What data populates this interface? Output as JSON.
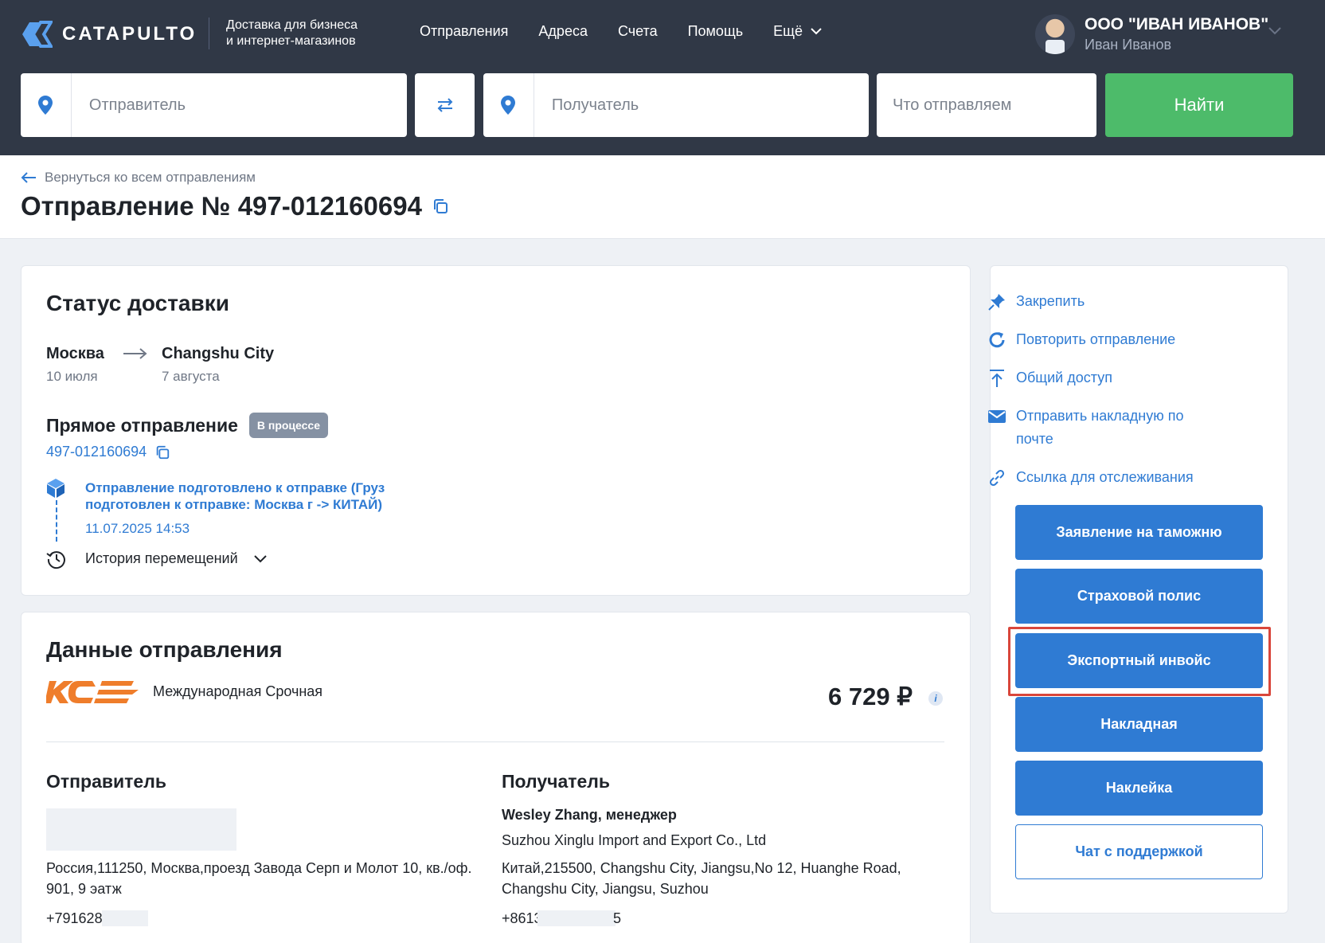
{
  "header": {
    "brand": "CATAPULTO",
    "tagline_line1": "Доставка для бизнеса",
    "tagline_line2": "и интернет-магазинов",
    "nav": [
      {
        "label": "Отправления"
      },
      {
        "label": "Адреса"
      },
      {
        "label": "Счета"
      },
      {
        "label": "Помощь"
      },
      {
        "label": "Ещё"
      }
    ],
    "account": {
      "company": "ООО \"ИВАН ИВАНОВ\"",
      "user": "Иван Иванов"
    }
  },
  "search": {
    "sender_placeholder": "Отправитель",
    "recipient_placeholder": "Получатель",
    "what_placeholder": "Что отправляем",
    "find_label": "Найти"
  },
  "page": {
    "back_label": "Вернуться ко всем отправлениям",
    "title": "Отправление № 497-012160694"
  },
  "status": {
    "heading": "Статус доставки",
    "from_city": "Москва",
    "from_date": "10 июля",
    "to_city": "Changshu City",
    "to_date": "7 августа",
    "direct_label": "Прямое отправление",
    "badge": "В процессе",
    "tracking_number": "497-012160694",
    "event_title": "Отправление подготовлено к отправке (Груз подготовлен к отправке: Москва г -> КИТАЙ)",
    "event_time": "11.07.2025 14:53",
    "history_label": "История перемещений"
  },
  "shipment": {
    "heading": "Данные отправления",
    "service": "Международная Срочная",
    "price": "6 729 ₽",
    "info": "i",
    "sender": {
      "heading": "Отправитель",
      "address": "Россия,111250, Москва,проезд Завода Серп и Молот 10, кв./оф. 901, 9 эатж",
      "phone": "+791628"
    },
    "recipient": {
      "heading": "Получатель",
      "name": "Wesley Zhang, менеджер",
      "company": "Suzhou Xinglu Import and Export Co., Ltd",
      "address": "Китай,215500, Changshu City, Jiangsu,No 12, Huanghe Road, Changshu City, Jiangsu, Suzhou",
      "phone_prefix": "+8613",
      "phone_suffix": "5"
    }
  },
  "actions": {
    "links": [
      {
        "label": "Закрепить"
      },
      {
        "label": "Повторить отправление"
      },
      {
        "label": "Общий доступ"
      },
      {
        "label": "Отправить накладную по почте"
      },
      {
        "label": "Ссылка для отслеживания"
      }
    ],
    "buttons": [
      {
        "label": "Заявление на таможню"
      },
      {
        "label": "Страховой полис"
      },
      {
        "label": "Экспортный инвойс"
      },
      {
        "label": "Накладная"
      },
      {
        "label": "Наклейка"
      }
    ],
    "support_label": "Чат с поддержкой"
  },
  "colors": {
    "header_bg": "#303846",
    "accent_blue": "#2f7bd3",
    "find_green": "#4dbb6a",
    "badge_gray": "#8591a3",
    "highlight_red": "#d9463b",
    "kse_orange": "#ef7d2b"
  }
}
